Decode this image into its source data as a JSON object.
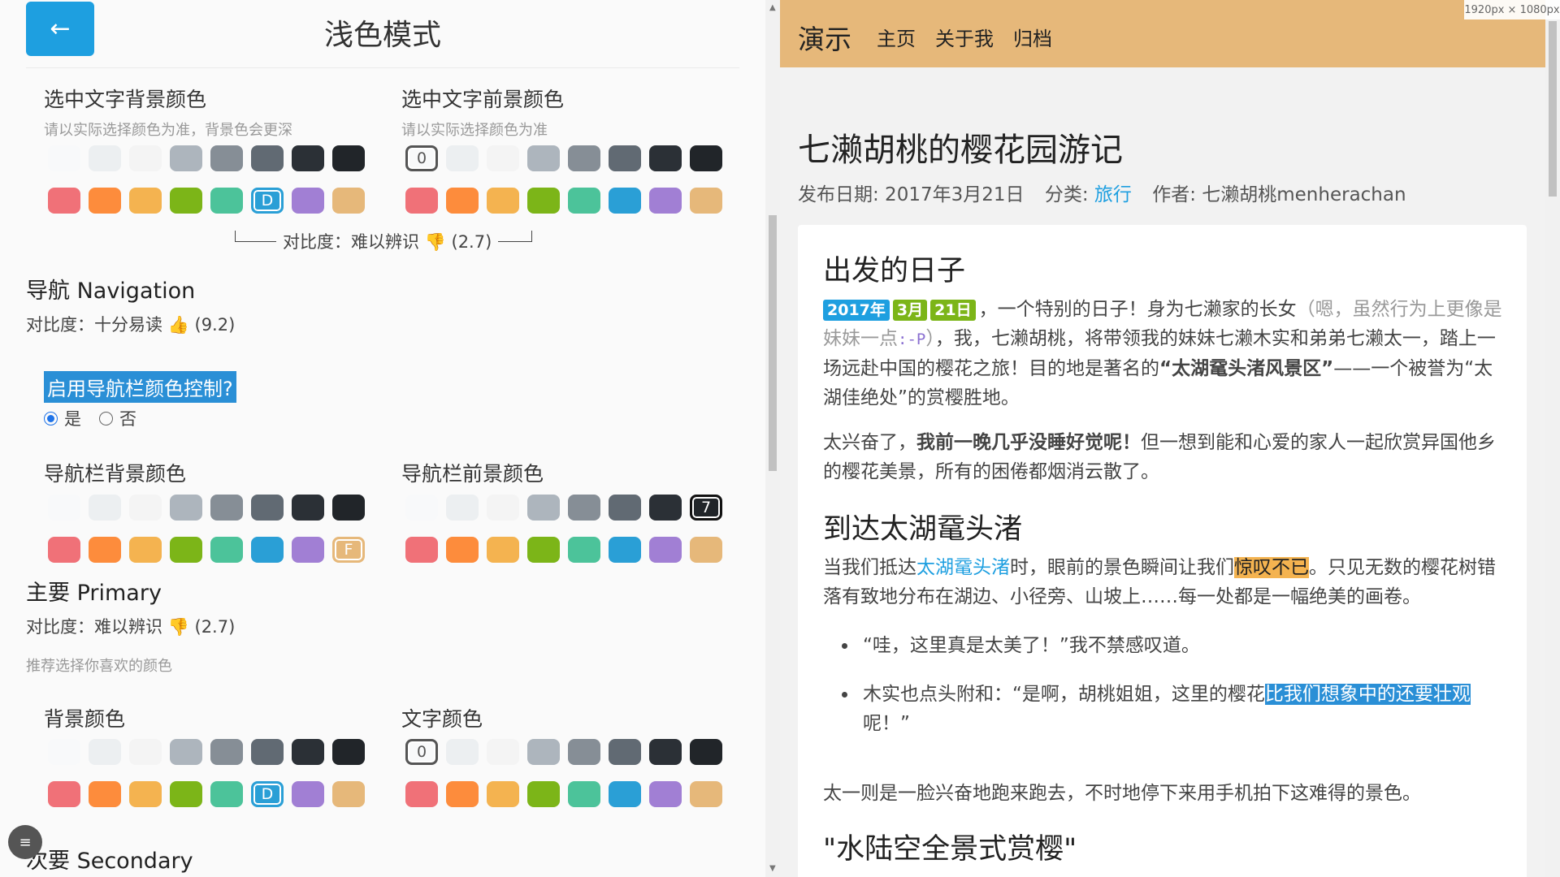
{
  "left_panel": {
    "back_icon": "←",
    "title": "浅色模式",
    "selection": {
      "bg_label": "选中文字背景颜色",
      "bg_hint": "请以实际选择颜色为准，背景色会更深",
      "fg_label": "选中文字前景颜色",
      "fg_hint": "请以实际选择颜色为准",
      "contrast_text": "对比度：难以辨识 👎 (2.7)"
    },
    "navigation": {
      "heading": "导航 Navigation",
      "contrast_text": "对比度：十分易读 👍 (9.2)",
      "question": "启用导航栏颜色控制?",
      "radio_yes": "是",
      "radio_no": "否",
      "bg_label": "导航栏背景颜色",
      "fg_label": "导航栏前景颜色"
    },
    "primary": {
      "heading": "主要 Primary",
      "contrast_text": "对比度：难以辨识 👎 (2.7)",
      "hint": "推荐选择你喜欢的颜色",
      "bg_label": "背景颜色",
      "fg_label": "文字颜色"
    },
    "secondary_heading": "次要 Secondary",
    "menu_icon": "≡",
    "swatch_marks": {
      "zero": "0",
      "d": "D",
      "f": "F",
      "seven": "7"
    },
    "palette": {
      "neutral": [
        "#f8f9fa",
        "#eceff1",
        "#f4f4f4",
        "#adb5bd",
        "#868e96",
        "#616a73",
        "#2b3036",
        "#212529"
      ],
      "colors": [
        "#f07178",
        "#fd8c3c",
        "#f4b350",
        "#7cb518",
        "#4cc39a",
        "#2a9fd6",
        "#a17fd4",
        "#e6b87a"
      ]
    }
  },
  "right_panel": {
    "brand": "演示",
    "nav_links": [
      "主页",
      "关于我",
      "归档"
    ],
    "dimension_badge": "1920px × 1080px",
    "post_title": "七濑胡桃的樱花园游记",
    "meta": {
      "date_label": "发布日期: 2017年3月21日",
      "cat_label": "分类:",
      "cat_value": "旅行",
      "author": "作者: 七濑胡桃menherachan"
    },
    "sections": {
      "h1": "出发的日子",
      "badge_year": "2017年",
      "badge_month": "3月",
      "badge_day": "21日",
      "p1_a": "，一个特别的日子！身为七濑家的长女",
      "p1_muted": "（嗯，虽然行为上更像是妹妹一点",
      "p1_code": ":-P",
      "p1_muted_end": "）",
      "p1_b": "，我，七濑胡桃，将带领我的妹妹七濑木实和弟弟七濑太一，踏上一场远赴中国的樱花之旅！目的地是著名的",
      "p1_bold": "“太湖鼋头渚风景区”",
      "p1_c": "——一个被誉为“太湖佳绝处”的赏樱胜地。",
      "p2_a": "太兴奋了，",
      "p2_bold": "我前一晚几乎没睡好觉呢！",
      "p2_b": "但一想到能和心爱的家人一起欣赏异国他乡的樱花美景，所有的困倦都烟消云散了。",
      "h2": "到达太湖鼋头渚",
      "p3_a": "当我们抵达",
      "p3_link": "太湖鼋头渚",
      "p3_b": "时，眼前的景色瞬间让我们",
      "p3_mark": "惊叹不已",
      "p3_c": "。只见无数的樱花树错落有致地分布在湖边、小径旁、山坡上……每一处都是一幅绝美的画卷。",
      "li1": "“哇，这里真是太美了！”我不禁感叹道。",
      "li2_a": "木实也点头附和：“是啊，胡桃姐姐，这里的樱花",
      "li2_mark": "比我们想象中的还要壮观",
      "li2_b": "呢！”",
      "p4": "太一则是一脸兴奋地跑来跑去，不时地停下来用手机拍下这难得的景色。",
      "h3": "\"水陆空全景式赏樱\""
    }
  }
}
